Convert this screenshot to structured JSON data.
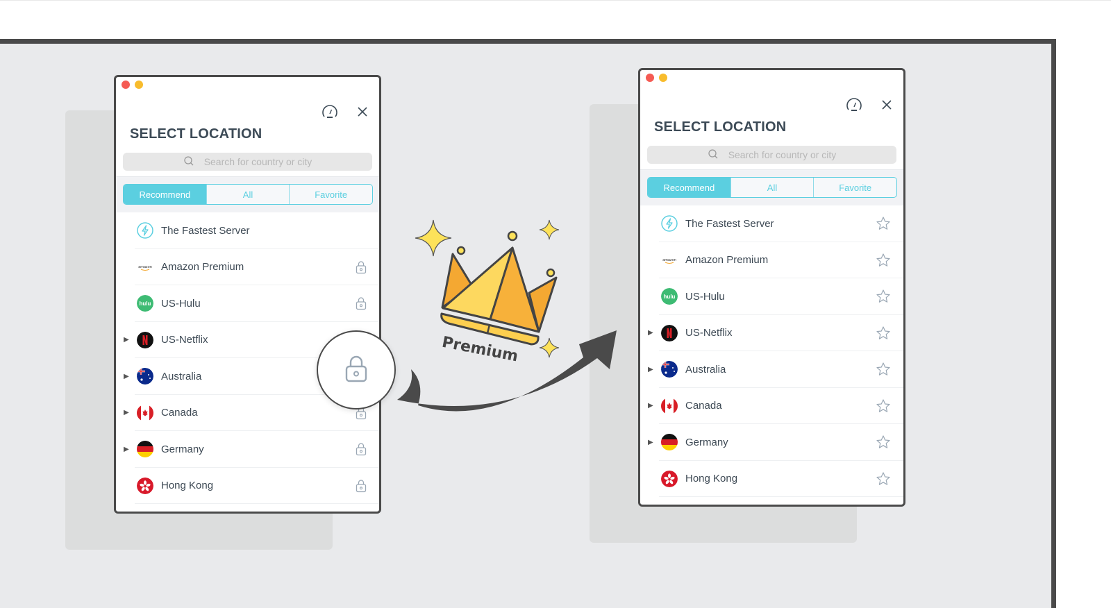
{
  "colors": {
    "accent": "#5bcfe0",
    "frame_border": "#4a4a4a",
    "background": "#e9eaec",
    "title_text": "#3c4a56",
    "lock_icon": "#9aa7b4",
    "crown_light": "#fdd85f",
    "crown_dark": "#f7b13a"
  },
  "before_window": {
    "title": "SELECT LOCATION",
    "search_placeholder": "Search for country or city",
    "tabs": [
      {
        "label": "Recommend",
        "active": true
      },
      {
        "label": "All",
        "active": false
      },
      {
        "label": "Favorite",
        "active": false
      }
    ],
    "items": [
      {
        "label": "The Fastest Server",
        "icon": "lightning-icon",
        "expandable": false,
        "action": "none"
      },
      {
        "label": "Amazon Premium",
        "icon": "amazon-logo-icon",
        "expandable": false,
        "action": "lock-icon"
      },
      {
        "label": "US-Hulu",
        "icon": "hulu-logo-icon",
        "expandable": false,
        "action": "lock-icon"
      },
      {
        "label": "US-Netflix",
        "icon": "netflix-logo-icon",
        "expandable": true,
        "action": "lock-icon"
      },
      {
        "label": "Australia",
        "icon": "australia-flag-icon",
        "expandable": true,
        "action": "lock-icon"
      },
      {
        "label": "Canada",
        "icon": "canada-flag-icon",
        "expandable": true,
        "action": "lock-icon"
      },
      {
        "label": "Germany",
        "icon": "germany-flag-icon",
        "expandable": true,
        "action": "lock-icon"
      },
      {
        "label": "Hong Kong",
        "icon": "hong-kong-flag-icon",
        "expandable": false,
        "action": "lock-icon"
      }
    ]
  },
  "after_window": {
    "title": "SELECT LOCATION",
    "search_placeholder": "Search for country or city",
    "tabs": [
      {
        "label": "Recommend",
        "active": true
      },
      {
        "label": "All",
        "active": false
      },
      {
        "label": "Favorite",
        "active": false
      }
    ],
    "items": [
      {
        "label": "The Fastest Server",
        "icon": "lightning-icon",
        "expandable": false,
        "action": "star-icon"
      },
      {
        "label": "Amazon Premium",
        "icon": "amazon-logo-icon",
        "expandable": false,
        "action": "star-icon"
      },
      {
        "label": "US-Hulu",
        "icon": "hulu-logo-icon",
        "expandable": false,
        "action": "star-icon"
      },
      {
        "label": "US-Netflix",
        "icon": "netflix-logo-icon",
        "expandable": true,
        "action": "star-icon"
      },
      {
        "label": "Australia",
        "icon": "australia-flag-icon",
        "expandable": true,
        "action": "star-icon"
      },
      {
        "label": "Canada",
        "icon": "canada-flag-icon",
        "expandable": true,
        "action": "star-icon"
      },
      {
        "label": "Germany",
        "icon": "germany-flag-icon",
        "expandable": true,
        "action": "star-icon"
      },
      {
        "label": "Hong Kong",
        "icon": "hong-kong-flag-icon",
        "expandable": false,
        "action": "star-icon"
      }
    ]
  },
  "premium_badge": {
    "label": "Premium",
    "icon": "crown-icon"
  },
  "icons": {
    "speed": "speedometer-icon",
    "close": "close-icon",
    "search": "search-icon",
    "expand": "▶",
    "magnified": "lock-icon",
    "transition": "curved-arrow-icon"
  }
}
